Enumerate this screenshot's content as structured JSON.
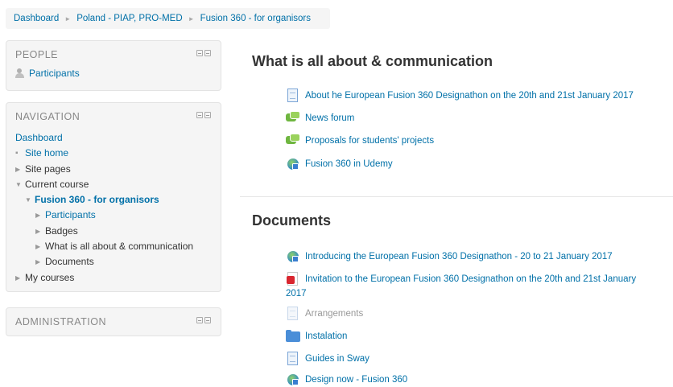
{
  "breadcrumb": {
    "items": [
      "Dashboard",
      "Poland - PIAP, PRO-MED",
      "Fusion 360 - for organisors"
    ]
  },
  "people_block": {
    "title": "PEOPLE",
    "participants": "Participants"
  },
  "navigation_block": {
    "title": "NAVIGATION",
    "dashboard": "Dashboard",
    "site_home": "Site home",
    "site_pages": "Site pages",
    "current_course": "Current course",
    "course_name": "Fusion 360 - for organisors",
    "course_items": [
      "Participants",
      "Badges",
      "What is all about & communication",
      "Documents"
    ],
    "my_courses": "My courses"
  },
  "admin_block": {
    "title": "ADMINISTRATION"
  },
  "sections": [
    {
      "title": "What is all about & communication",
      "activities": [
        {
          "icon": "page-icon",
          "label": "About he European Fusion 360 Designathon on the 20th and 21st January 2017"
        },
        {
          "icon": "forum-icon",
          "label": "News forum"
        },
        {
          "icon": "forum-icon",
          "label": "Proposals for students' projects"
        },
        {
          "icon": "url-icon",
          "label": "Fusion 360 in Udemy"
        }
      ]
    },
    {
      "title": "Documents",
      "activities": [
        {
          "icon": "url-icon",
          "label": "Introducing the European Fusion 360 Designathon - 20 to 21 January 2017"
        },
        {
          "icon": "pdf-icon",
          "label": "Invitation to the European Fusion 360 Designathon on the 20th and 21st January",
          "label_cont": "2017"
        },
        {
          "icon": "page-icon",
          "label": "Arrangements",
          "dimmed": true
        },
        {
          "icon": "folder-icon",
          "label": "Instalation"
        },
        {
          "icon": "page-icon",
          "label": "Guides in Sway"
        },
        {
          "icon": "url-icon",
          "label": "Design now - Fusion 360"
        }
      ]
    }
  ],
  "colors": {
    "link": "#0070a8",
    "block_bg": "#f5f5f5",
    "title_text": "#333333"
  }
}
